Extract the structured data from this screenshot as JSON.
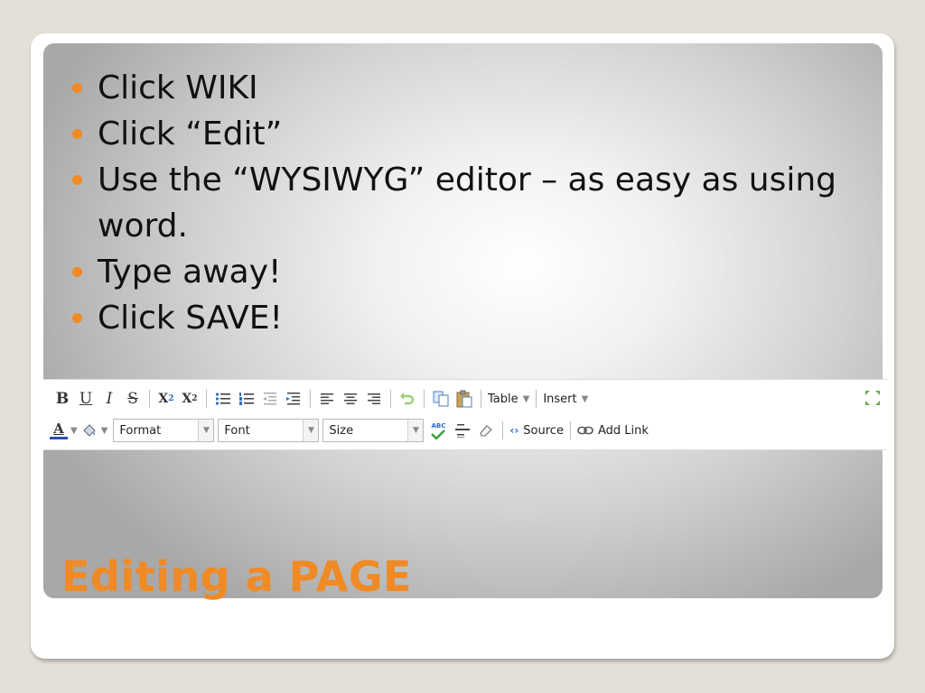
{
  "slide": {
    "bullets": [
      "Click WIKI",
      "Click “Edit”",
      "Use the “WYSIWYG” editor – as easy as using word.",
      "Type away!",
      "Click SAVE!"
    ],
    "title": "Editing a PAGE"
  },
  "toolbar": {
    "bold": "B",
    "underline": "U",
    "italic": "I",
    "strike": "S",
    "subscript": "X",
    "subscript_mark": "2",
    "superscript": "X",
    "superscript_mark": "2",
    "table_label": "Table",
    "insert_label": "Insert",
    "text_color_letter": "A",
    "format_select": "Format",
    "font_select": "Font",
    "size_select": "Size",
    "spell_label": "ABC",
    "source_label": "Source",
    "add_link_label": "Add Link"
  },
  "colors": {
    "accent": "#f08a24",
    "text_color_bar": "#2a4fb0"
  }
}
